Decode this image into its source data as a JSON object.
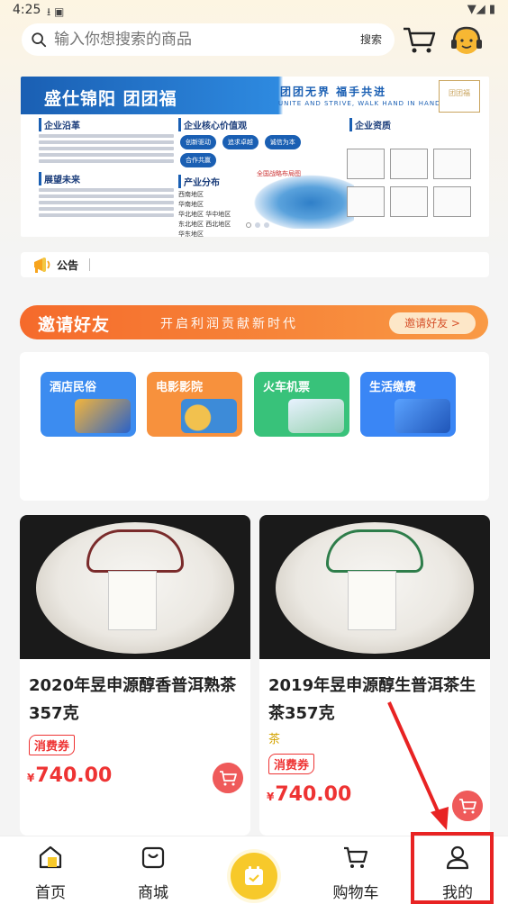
{
  "status_bar": {
    "time": "4:25",
    "left_icons": "⭳ ▣",
    "right_icons": "▼◢ ▮"
  },
  "search": {
    "placeholder": "输入你想搜索的商品",
    "button_label": "搜索"
  },
  "banner": {
    "title": "盛仕锦阳 团团福",
    "slogan": "团团无界  福手共进",
    "slogan_en": "UNITE AND STRIVE, WALK HAND IN HAND",
    "logo_text": "团团福",
    "col1_title": "企业沿革",
    "col1_title2": "展望未来",
    "col2_title": "企业核心价值观",
    "col2_chips": [
      "创新驱动",
      "追求卓越",
      "诚信为本",
      "合作共赢"
    ],
    "col2_title2": "产业分布",
    "regions": [
      "西南地区",
      "华南地区",
      "华北地区  华中地区",
      "东北地区  西北地区",
      "华东地区"
    ],
    "map_label": "全国战略布局图",
    "col3_title": "企业资质"
  },
  "notice": {
    "label": "公告"
  },
  "invite": {
    "title": "邀请好友",
    "subtitle": "开启利润贡献新时代",
    "button_label": "邀请好友 >"
  },
  "services": [
    {
      "label": "酒店民俗",
      "color": "#3c8cf0",
      "art_color": "#f5b53a"
    },
    {
      "label": "电影影院",
      "color": "#f7913d",
      "art_color": "#3d8bd8"
    },
    {
      "label": "火车机票",
      "color": "#38c27a",
      "art_color": "#e8f2ff"
    },
    {
      "label": "生活缴费",
      "color": "#3a86f5",
      "art_color": "#2a66c9"
    }
  ],
  "products": [
    {
      "title": "2020年昱申源醇香普洱熟茶357克",
      "tag": "",
      "coupon": "消费券",
      "currency": "¥",
      "price": "740.00",
      "crest_color": "#7a2b2b"
    },
    {
      "title": "2019年昱申源醇生普洱茶生茶357克",
      "tag": "茶",
      "coupon": "消费券",
      "currency": "¥",
      "price": "740.00",
      "crest_color": "#2e7d4a"
    }
  ],
  "bottom_nav": {
    "home": "首页",
    "mall": "商城",
    "cart": "购物车",
    "mine": "我的"
  },
  "colors": {
    "accent_red": "#e33333",
    "invite_orange": "#f56a2b",
    "center_yellow": "#f7c92a"
  }
}
